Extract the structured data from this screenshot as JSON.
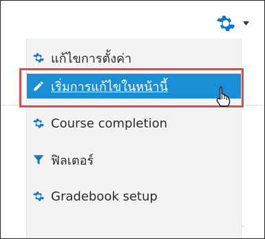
{
  "settings_menu": {
    "trigger_icon": "gear-icon",
    "caret_icon": "chevron-down-icon",
    "items": [
      {
        "label": "แก้ไขการตั้งค่า",
        "icon": "gear-icon",
        "active": false
      },
      {
        "label": "เริ่มการแก้ไขในหน้านี้",
        "icon": "pencil-icon",
        "active": true
      },
      {
        "label": "Course completion",
        "icon": "gear-icon",
        "active": false
      },
      {
        "label": "ฟิลเตอร์",
        "icon": "filter-icon",
        "active": false
      },
      {
        "label": "Gradebook setup",
        "icon": "gear-icon",
        "active": false
      }
    ]
  },
  "colors": {
    "accent": "#1a8fd6",
    "icon_blue": "#1177c8",
    "highlight_red": "#e04a4a",
    "menu_bg": "#f3f3f3"
  }
}
